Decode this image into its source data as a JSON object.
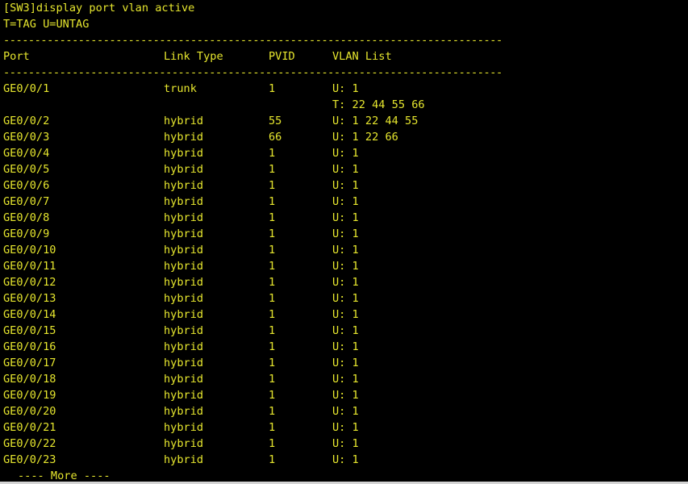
{
  "prompt_line": "[SW3]display port vlan active",
  "legend": "T=TAG U=UNTAG",
  "separator": "--------------------------------------------------------------------------------",
  "headers": {
    "port": "Port",
    "link_type": "Link Type",
    "pvid": "PVID",
    "vlan_list": "VLAN List"
  },
  "rows": [
    {
      "port": "GE0/0/1",
      "type": "trunk",
      "pvid": "1",
      "vlan": "U: 1"
    },
    {
      "port": "",
      "type": "",
      "pvid": "",
      "vlan": "T: 22 44 55 66"
    },
    {
      "port": "GE0/0/2",
      "type": "hybrid",
      "pvid": "55",
      "vlan": "U: 1 22 44 55"
    },
    {
      "port": "GE0/0/3",
      "type": "hybrid",
      "pvid": "66",
      "vlan": "U: 1 22 66"
    },
    {
      "port": "GE0/0/4",
      "type": "hybrid",
      "pvid": "1",
      "vlan": "U: 1"
    },
    {
      "port": "GE0/0/5",
      "type": "hybrid",
      "pvid": "1",
      "vlan": "U: 1"
    },
    {
      "port": "GE0/0/6",
      "type": "hybrid",
      "pvid": "1",
      "vlan": "U: 1"
    },
    {
      "port": "GE0/0/7",
      "type": "hybrid",
      "pvid": "1",
      "vlan": "U: 1"
    },
    {
      "port": "GE0/0/8",
      "type": "hybrid",
      "pvid": "1",
      "vlan": "U: 1"
    },
    {
      "port": "GE0/0/9",
      "type": "hybrid",
      "pvid": "1",
      "vlan": "U: 1"
    },
    {
      "port": "GE0/0/10",
      "type": "hybrid",
      "pvid": "1",
      "vlan": "U: 1"
    },
    {
      "port": "GE0/0/11",
      "type": "hybrid",
      "pvid": "1",
      "vlan": "U: 1"
    },
    {
      "port": "GE0/0/12",
      "type": "hybrid",
      "pvid": "1",
      "vlan": "U: 1"
    },
    {
      "port": "GE0/0/13",
      "type": "hybrid",
      "pvid": "1",
      "vlan": "U: 1"
    },
    {
      "port": "GE0/0/14",
      "type": "hybrid",
      "pvid": "1",
      "vlan": "U: 1"
    },
    {
      "port": "GE0/0/15",
      "type": "hybrid",
      "pvid": "1",
      "vlan": "U: 1"
    },
    {
      "port": "GE0/0/16",
      "type": "hybrid",
      "pvid": "1",
      "vlan": "U: 1"
    },
    {
      "port": "GE0/0/17",
      "type": "hybrid",
      "pvid": "1",
      "vlan": "U: 1"
    },
    {
      "port": "GE0/0/18",
      "type": "hybrid",
      "pvid": "1",
      "vlan": "U: 1"
    },
    {
      "port": "GE0/0/19",
      "type": "hybrid",
      "pvid": "1",
      "vlan": "U: 1"
    },
    {
      "port": "GE0/0/20",
      "type": "hybrid",
      "pvid": "1",
      "vlan": "U: 1"
    },
    {
      "port": "GE0/0/21",
      "type": "hybrid",
      "pvid": "1",
      "vlan": "U: 1"
    },
    {
      "port": "GE0/0/22",
      "type": "hybrid",
      "pvid": "1",
      "vlan": "U: 1"
    },
    {
      "port": "GE0/0/23",
      "type": "hybrid",
      "pvid": "1",
      "vlan": "U: 1"
    }
  ],
  "more_prompt": "---- More ----",
  "colors": {
    "background": "#000000",
    "text": "#e6e62e"
  }
}
